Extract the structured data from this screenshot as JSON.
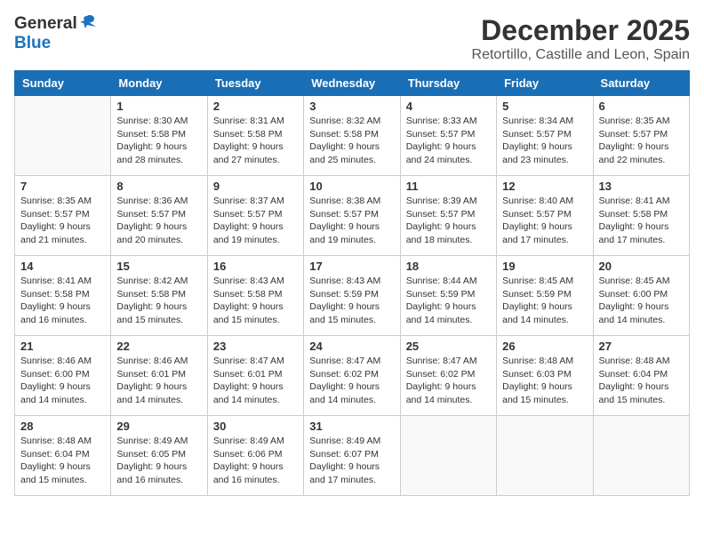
{
  "logo": {
    "general": "General",
    "blue": "Blue"
  },
  "title": "December 2025",
  "location": "Retortillo, Castille and Leon, Spain",
  "days_of_week": [
    "Sunday",
    "Monday",
    "Tuesday",
    "Wednesday",
    "Thursday",
    "Friday",
    "Saturday"
  ],
  "weeks": [
    [
      {
        "day": "",
        "text": ""
      },
      {
        "day": "1",
        "text": "Sunrise: 8:30 AM\nSunset: 5:58 PM\nDaylight: 9 hours\nand 28 minutes."
      },
      {
        "day": "2",
        "text": "Sunrise: 8:31 AM\nSunset: 5:58 PM\nDaylight: 9 hours\nand 27 minutes."
      },
      {
        "day": "3",
        "text": "Sunrise: 8:32 AM\nSunset: 5:58 PM\nDaylight: 9 hours\nand 25 minutes."
      },
      {
        "day": "4",
        "text": "Sunrise: 8:33 AM\nSunset: 5:57 PM\nDaylight: 9 hours\nand 24 minutes."
      },
      {
        "day": "5",
        "text": "Sunrise: 8:34 AM\nSunset: 5:57 PM\nDaylight: 9 hours\nand 23 minutes."
      },
      {
        "day": "6",
        "text": "Sunrise: 8:35 AM\nSunset: 5:57 PM\nDaylight: 9 hours\nand 22 minutes."
      }
    ],
    [
      {
        "day": "7",
        "text": "Sunrise: 8:35 AM\nSunset: 5:57 PM\nDaylight: 9 hours\nand 21 minutes."
      },
      {
        "day": "8",
        "text": "Sunrise: 8:36 AM\nSunset: 5:57 PM\nDaylight: 9 hours\nand 20 minutes."
      },
      {
        "day": "9",
        "text": "Sunrise: 8:37 AM\nSunset: 5:57 PM\nDaylight: 9 hours\nand 19 minutes."
      },
      {
        "day": "10",
        "text": "Sunrise: 8:38 AM\nSunset: 5:57 PM\nDaylight: 9 hours\nand 19 minutes."
      },
      {
        "day": "11",
        "text": "Sunrise: 8:39 AM\nSunset: 5:57 PM\nDaylight: 9 hours\nand 18 minutes."
      },
      {
        "day": "12",
        "text": "Sunrise: 8:40 AM\nSunset: 5:57 PM\nDaylight: 9 hours\nand 17 minutes."
      },
      {
        "day": "13",
        "text": "Sunrise: 8:41 AM\nSunset: 5:58 PM\nDaylight: 9 hours\nand 17 minutes."
      }
    ],
    [
      {
        "day": "14",
        "text": "Sunrise: 8:41 AM\nSunset: 5:58 PM\nDaylight: 9 hours\nand 16 minutes."
      },
      {
        "day": "15",
        "text": "Sunrise: 8:42 AM\nSunset: 5:58 PM\nDaylight: 9 hours\nand 15 minutes."
      },
      {
        "day": "16",
        "text": "Sunrise: 8:43 AM\nSunset: 5:58 PM\nDaylight: 9 hours\nand 15 minutes."
      },
      {
        "day": "17",
        "text": "Sunrise: 8:43 AM\nSunset: 5:59 PM\nDaylight: 9 hours\nand 15 minutes."
      },
      {
        "day": "18",
        "text": "Sunrise: 8:44 AM\nSunset: 5:59 PM\nDaylight: 9 hours\nand 14 minutes."
      },
      {
        "day": "19",
        "text": "Sunrise: 8:45 AM\nSunset: 5:59 PM\nDaylight: 9 hours\nand 14 minutes."
      },
      {
        "day": "20",
        "text": "Sunrise: 8:45 AM\nSunset: 6:00 PM\nDaylight: 9 hours\nand 14 minutes."
      }
    ],
    [
      {
        "day": "21",
        "text": "Sunrise: 8:46 AM\nSunset: 6:00 PM\nDaylight: 9 hours\nand 14 minutes."
      },
      {
        "day": "22",
        "text": "Sunrise: 8:46 AM\nSunset: 6:01 PM\nDaylight: 9 hours\nand 14 minutes."
      },
      {
        "day": "23",
        "text": "Sunrise: 8:47 AM\nSunset: 6:01 PM\nDaylight: 9 hours\nand 14 minutes."
      },
      {
        "day": "24",
        "text": "Sunrise: 8:47 AM\nSunset: 6:02 PM\nDaylight: 9 hours\nand 14 minutes."
      },
      {
        "day": "25",
        "text": "Sunrise: 8:47 AM\nSunset: 6:02 PM\nDaylight: 9 hours\nand 14 minutes."
      },
      {
        "day": "26",
        "text": "Sunrise: 8:48 AM\nSunset: 6:03 PM\nDaylight: 9 hours\nand 15 minutes."
      },
      {
        "day": "27",
        "text": "Sunrise: 8:48 AM\nSunset: 6:04 PM\nDaylight: 9 hours\nand 15 minutes."
      }
    ],
    [
      {
        "day": "28",
        "text": "Sunrise: 8:48 AM\nSunset: 6:04 PM\nDaylight: 9 hours\nand 15 minutes."
      },
      {
        "day": "29",
        "text": "Sunrise: 8:49 AM\nSunset: 6:05 PM\nDaylight: 9 hours\nand 16 minutes."
      },
      {
        "day": "30",
        "text": "Sunrise: 8:49 AM\nSunset: 6:06 PM\nDaylight: 9 hours\nand 16 minutes."
      },
      {
        "day": "31",
        "text": "Sunrise: 8:49 AM\nSunset: 6:07 PM\nDaylight: 9 hours\nand 17 minutes."
      },
      {
        "day": "",
        "text": ""
      },
      {
        "day": "",
        "text": ""
      },
      {
        "day": "",
        "text": ""
      }
    ]
  ]
}
